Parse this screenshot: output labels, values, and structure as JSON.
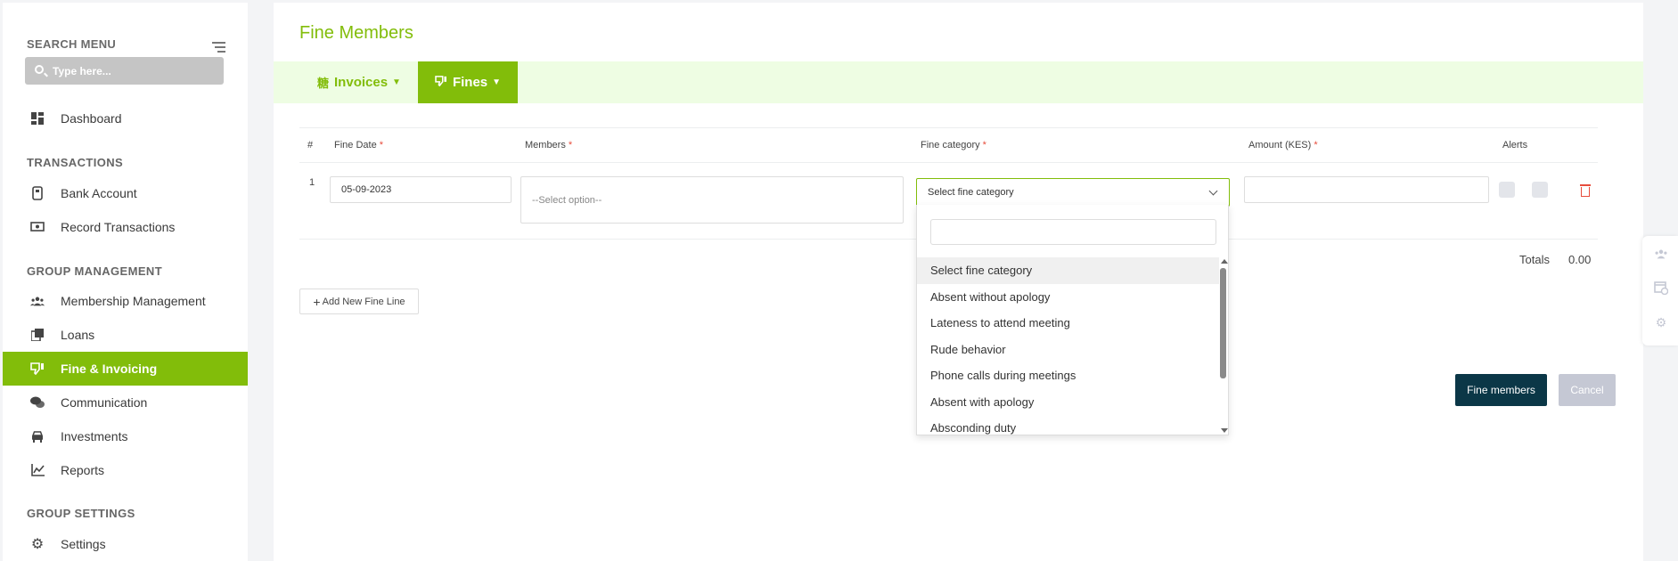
{
  "sidebar": {
    "search_menu_label": "SEARCH MENU",
    "search_placeholder": "Type here...",
    "sections": {
      "transactions": "TRANSACTIONS",
      "group_management": "GROUP MANAGEMENT",
      "group_settings": "GROUP SETTINGS"
    },
    "items": {
      "dashboard": "Dashboard",
      "bank_account": "Bank Account",
      "record_transactions": "Record Transactions",
      "membership_management": "Membership Management",
      "loans": "Loans",
      "fine_invoicing": "Fine & Invoicing",
      "communication": "Communication",
      "investments": "Investments",
      "reports": "Reports",
      "settings": "Settings"
    },
    "active_item": "fine_invoicing"
  },
  "main": {
    "title": "Fine Members",
    "tabs": {
      "invoices": "Invoices",
      "fines": "Fines"
    },
    "table": {
      "headers": {
        "num": "#",
        "fine_date": "Fine Date",
        "members": "Members",
        "fine_category": "Fine category",
        "amount": "Amount (KES)",
        "alerts": "Alerts"
      },
      "required_mark": "*",
      "row": {
        "number": "1",
        "fine_date": "05-09-2023",
        "members_placeholder": "--Select option--",
        "fine_category_selected": "Select fine category",
        "amount": ""
      }
    },
    "totals_label": "Totals",
    "totals_value": "0.00",
    "add_line_label": "Add New Fine Line",
    "fine_button_label": "Fine members",
    "cancel_button_label": "Cancel"
  },
  "dropdown": {
    "search_value": "",
    "options": [
      "Select fine category",
      "Absent without apology",
      "Lateness to attend meeting",
      "Rude behavior",
      "Phone calls during meetings",
      "Absent with apology",
      "Absconding duty"
    ],
    "highlighted_index": 0
  },
  "colors": {
    "brand_green": "#82bd0a",
    "tab_bar_bg": "#eefde3",
    "primary_button": "#0b3747",
    "cancel_button": "#c5c8d4",
    "danger": "#e74c3c"
  },
  "icons": {
    "sidebar": [
      "dashboard-icon",
      "bank-icon",
      "money-icon",
      "people-icon",
      "loans-icon",
      "thumbs-down-icon",
      "chat-icon",
      "car-icon",
      "chart-icon",
      "gear-icon"
    ],
    "float_panel": [
      "people-icon",
      "calendar-clock-icon",
      "gear-icon"
    ]
  }
}
